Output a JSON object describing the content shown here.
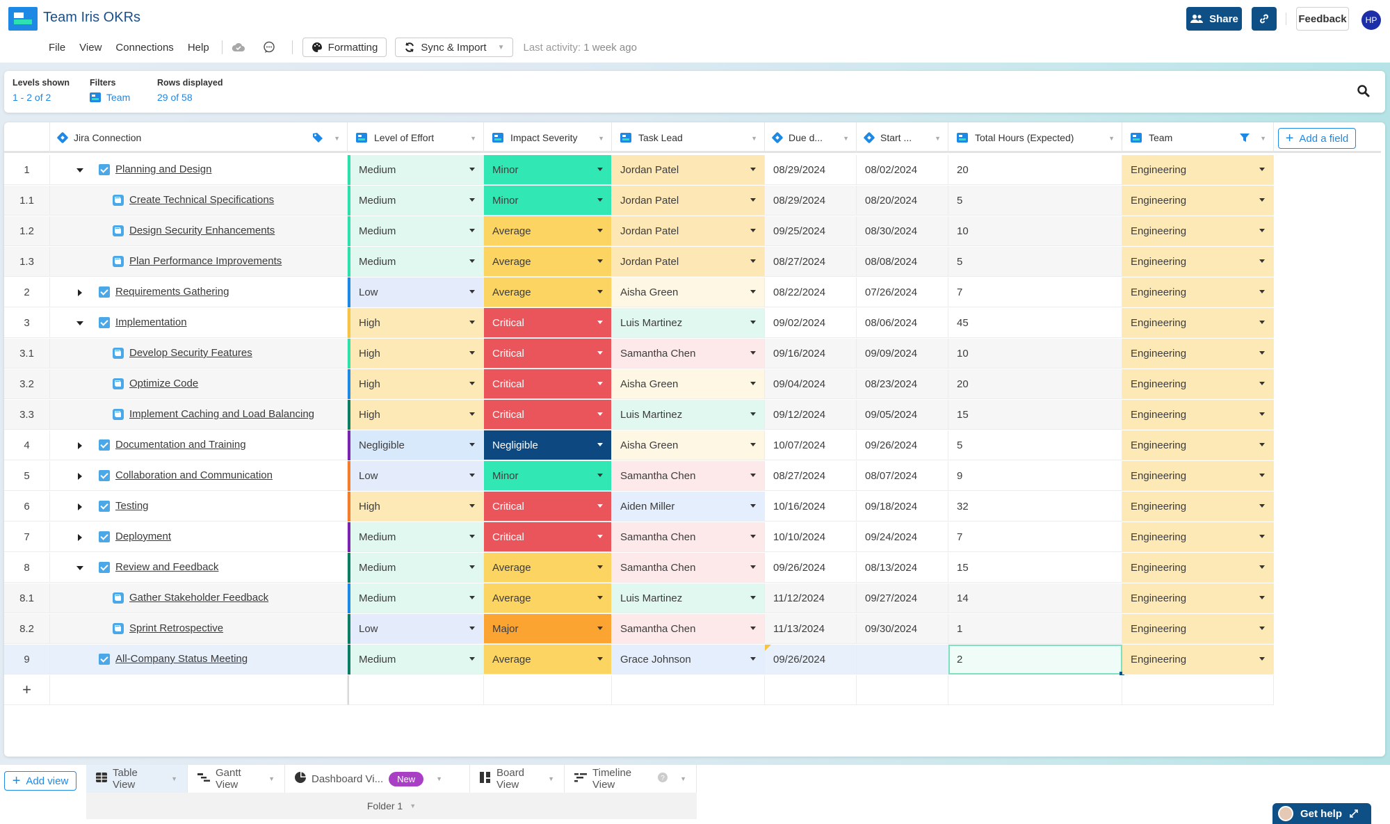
{
  "app": {
    "title": "Team Iris OKRs",
    "menu": [
      "File",
      "View",
      "Connections",
      "Help"
    ],
    "formatting_label": "Formatting",
    "sync_label": "Sync & Import",
    "last_activity_label": "Last activity:",
    "last_activity_value": "1 week ago",
    "share_label": "Share",
    "feedback_label": "Feedback",
    "avatar_initials": "HP"
  },
  "info_bar": {
    "levels_label": "Levels shown",
    "levels_value": "1 - 2 of 2",
    "filters_label": "Filters",
    "filters_value": "Team",
    "rows_label": "Rows displayed",
    "rows_value": "29 of 58"
  },
  "columns": [
    {
      "key": "jira",
      "label": "Jira Connection",
      "icon": "diamond"
    },
    {
      "key": "effort",
      "label": "Level of Effort",
      "icon": "field"
    },
    {
      "key": "impact",
      "label": "Impact Severity",
      "icon": "field"
    },
    {
      "key": "lead",
      "label": "Task Lead",
      "icon": "field"
    },
    {
      "key": "due",
      "label": "Due d...",
      "icon": "diamond"
    },
    {
      "key": "start",
      "label": "Start ...",
      "icon": "diamond"
    },
    {
      "key": "hours",
      "label": "Total Hours (Expected)",
      "icon": "field"
    },
    {
      "key": "team",
      "label": "Team",
      "icon": "field"
    }
  ],
  "add_field_label": "Add a field",
  "colors": {
    "effort": {
      "Medium": "#e0f8f0",
      "Low": "#e4ecfb",
      "High": "#fde9b6",
      "Negligible": "#d9e9fc"
    },
    "impact": {
      "Minor": "#31e8b5",
      "Average": "#fbd462",
      "Critical": "#e9555a",
      "Negligible": "#0d4880",
      "Major": "#fba432"
    },
    "lead": {
      "Jordan Patel": "#fde7b4",
      "Aisha Green": "#fef7e4",
      "Luis Martinez": "#e0f8ef",
      "Samantha Chen": "#fde9ea",
      "Aiden Miller": "#e4eefc",
      "Grace Johnson": "#e4eefc"
    },
    "team": "#fde9b6",
    "accent": {
      "teal": "#2ddfa9",
      "blue": "#1e88e5",
      "yellow": "#f6c342",
      "darkgreen": "#0c7c62",
      "purple": "#7b24b0",
      "orange": "#f47d2c",
      "navy": "#0d4880"
    }
  },
  "rows": [
    {
      "num": "1",
      "level": 1,
      "expand": "down",
      "task": "Planning and Design",
      "effort": "Medium",
      "impact": "Minor",
      "lead": "Jordan Patel",
      "due": "08/29/2024",
      "start": "08/02/2024",
      "hours": "20",
      "team": "Engineering",
      "accent": "teal"
    },
    {
      "num": "1.1",
      "level": 2,
      "expand": "",
      "task": "Create Technical Specifications",
      "effort": "Medium",
      "impact": "Minor",
      "lead": "Jordan Patel",
      "due": "08/29/2024",
      "start": "08/20/2024",
      "hours": "5",
      "team": "Engineering",
      "accent": "teal"
    },
    {
      "num": "1.2",
      "level": 2,
      "expand": "",
      "task": "Design Security Enhancements",
      "effort": "Medium",
      "impact": "Average",
      "lead": "Jordan Patel",
      "due": "09/25/2024",
      "start": "08/30/2024",
      "hours": "10",
      "team": "Engineering",
      "accent": "teal"
    },
    {
      "num": "1.3",
      "level": 2,
      "expand": "",
      "task": "Plan Performance Improvements",
      "effort": "Medium",
      "impact": "Average",
      "lead": "Jordan Patel",
      "due": "08/27/2024",
      "start": "08/08/2024",
      "hours": "5",
      "team": "Engineering",
      "accent": "teal"
    },
    {
      "num": "2",
      "level": 1,
      "expand": "right",
      "task": "Requirements Gathering",
      "effort": "Low",
      "impact": "Average",
      "lead": "Aisha Green",
      "due": "08/22/2024",
      "start": "07/26/2024",
      "hours": "7",
      "team": "Engineering",
      "accent": "blue"
    },
    {
      "num": "3",
      "level": 1,
      "expand": "down",
      "task": "Implementation",
      "effort": "High",
      "impact": "Critical",
      "lead": "Luis Martinez",
      "due": "09/02/2024",
      "start": "08/06/2024",
      "hours": "45",
      "team": "Engineering",
      "accent": "yellow"
    },
    {
      "num": "3.1",
      "level": 2,
      "expand": "",
      "task": "Develop Security Features",
      "effort": "High",
      "impact": "Critical",
      "lead": "Samantha Chen",
      "due": "09/16/2024",
      "start": "09/09/2024",
      "hours": "10",
      "team": "Engineering",
      "accent": "teal"
    },
    {
      "num": "3.2",
      "level": 2,
      "expand": "",
      "task": "Optimize Code",
      "effort": "High",
      "impact": "Critical",
      "lead": "Aisha Green",
      "due": "09/04/2024",
      "start": "08/23/2024",
      "hours": "20",
      "team": "Engineering",
      "accent": "blue"
    },
    {
      "num": "3.3",
      "level": 2,
      "expand": "",
      "task": "Implement Caching and Load Balancing",
      "effort": "High",
      "impact": "Critical",
      "lead": "Luis Martinez",
      "due": "09/12/2024",
      "start": "09/05/2024",
      "hours": "15",
      "team": "Engineering",
      "accent": "darkgreen"
    },
    {
      "num": "4",
      "level": 1,
      "expand": "right",
      "task": "Documentation and Training",
      "effort": "Negligible",
      "impact": "Negligible",
      "lead": "Aisha Green",
      "due": "10/07/2024",
      "start": "09/26/2024",
      "hours": "5",
      "team": "Engineering",
      "accent": "purple"
    },
    {
      "num": "5",
      "level": 1,
      "expand": "right",
      "task": "Collaboration and Communication",
      "effort": "Low",
      "impact": "Minor",
      "lead": "Samantha Chen",
      "due": "08/27/2024",
      "start": "08/07/2024",
      "hours": "9",
      "team": "Engineering",
      "accent": "orange"
    },
    {
      "num": "6",
      "level": 1,
      "expand": "right",
      "task": "Testing",
      "effort": "High",
      "impact": "Critical",
      "lead": "Aiden Miller",
      "due": "10/16/2024",
      "start": "09/18/2024",
      "hours": "32",
      "team": "Engineering",
      "accent": "orange"
    },
    {
      "num": "7",
      "level": 1,
      "expand": "right",
      "task": "Deployment",
      "effort": "Medium",
      "impact": "Critical",
      "lead": "Samantha Chen",
      "due": "10/10/2024",
      "start": "09/24/2024",
      "hours": "7",
      "team": "Engineering",
      "accent": "purple"
    },
    {
      "num": "8",
      "level": 1,
      "expand": "down",
      "task": "Review and Feedback",
      "effort": "Medium",
      "impact": "Average",
      "lead": "Samantha Chen",
      "due": "09/26/2024",
      "start": "08/13/2024",
      "hours": "15",
      "team": "Engineering",
      "accent": "darkgreen"
    },
    {
      "num": "8.1",
      "level": 2,
      "expand": "",
      "task": "Gather Stakeholder Feedback",
      "effort": "Medium",
      "impact": "Average",
      "lead": "Luis Martinez",
      "due": "11/12/2024",
      "start": "09/27/2024",
      "hours": "14",
      "team": "Engineering",
      "accent": "blue"
    },
    {
      "num": "8.2",
      "level": 2,
      "expand": "",
      "task": "Sprint Retrospective",
      "effort": "Low",
      "impact": "Major",
      "lead": "Samantha Chen",
      "due": "11/13/2024",
      "start": "09/30/2024",
      "hours": "1",
      "team": "Engineering",
      "accent": "darkgreen"
    },
    {
      "num": "9",
      "level": 1,
      "expand": "",
      "task": "All-Company Status Meeting",
      "effort": "Medium",
      "impact": "Average",
      "lead": "Grace Johnson",
      "due": "09/26/2024",
      "start": "",
      "hours": "2",
      "team": "Engineering",
      "accent": "darkgreen",
      "selected": true
    }
  ],
  "add_row_label": "+",
  "bottom": {
    "add_view_label": "Add view",
    "tabs": [
      {
        "label": "Table View",
        "icon": "table-icon",
        "active": true
      },
      {
        "label": "Gantt View",
        "icon": "gantt-icon"
      },
      {
        "label": "Dashboard Vi...",
        "icon": "dashboard-icon",
        "badge": "New"
      },
      {
        "label": "Board View",
        "icon": "board-icon"
      },
      {
        "label": "Timeline View",
        "icon": "timeline-icon",
        "help": true
      }
    ],
    "folder_label": "Folder 1",
    "get_help_label": "Get help"
  }
}
